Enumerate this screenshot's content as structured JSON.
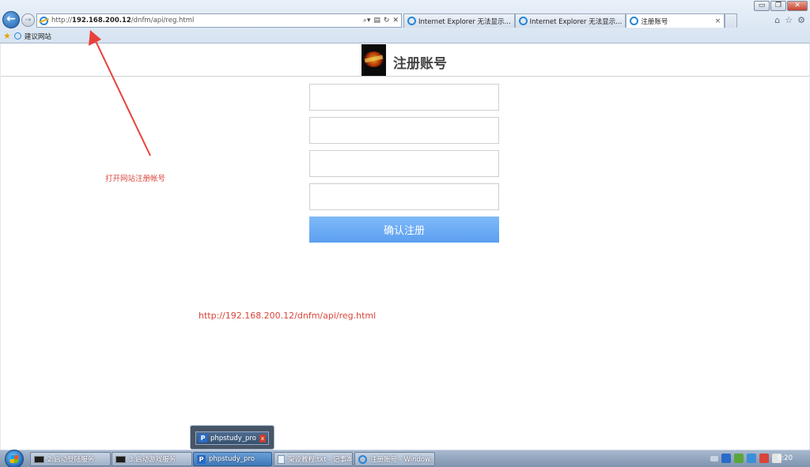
{
  "browser": {
    "window_controls": {
      "minimize": "▭",
      "restore": "❐",
      "close": "✕"
    },
    "back_glyph": "←",
    "forward_glyph": "→",
    "address": {
      "prefix": "http://",
      "host": "192.168.200.12",
      "path": "/dnfm/api/reg.html"
    },
    "address_tools": [
      "⌕▾",
      "▤",
      "↻",
      "✕"
    ],
    "tabs": [
      {
        "label": "Internet Explorer 无法显示...",
        "active": false
      },
      {
        "label": "Internet Explorer 无法显示...",
        "active": false
      },
      {
        "label": "注册账号",
        "active": true,
        "close": "×"
      }
    ],
    "ie_tools": [
      "⌂",
      "☆",
      "⚙"
    ],
    "favorites": {
      "star": "★",
      "item": "建议网站"
    }
  },
  "page": {
    "title": "注册账号",
    "fields": [
      "",
      "",
      "",
      ""
    ],
    "submit_label": "确认注册"
  },
  "annotations": {
    "arrow_color": "#e8413a",
    "note": "打开网站注册帐号",
    "url_note": "http://192.168.200.12/dnfm/api/reg.html"
  },
  "taskbar": {
    "thumbnail": {
      "icon": "P",
      "label": "phpstudy_pro",
      "close": "x"
    },
    "items": [
      {
        "label": "2.启动登陆服务",
        "icon": "cmd"
      },
      {
        "label": "3.启动游戏服务",
        "icon": "cmd"
      },
      {
        "label": "phpstudy_pro",
        "icon": "p",
        "active": true
      },
      {
        "label": "架设教程.txt - 记事本",
        "icon": "note"
      },
      {
        "label": "注册账号 - Window...",
        "icon": "ie"
      }
    ],
    "clock": "9:20"
  }
}
